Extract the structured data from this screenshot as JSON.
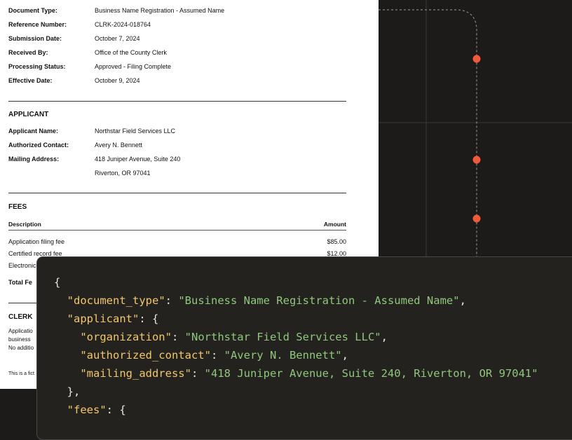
{
  "document": {
    "fields": [
      {
        "label": "Document Type:",
        "value": "Business Name Registration - Assumed Name"
      },
      {
        "label": "Reference Number:",
        "value": "CLRK-2024-018764"
      },
      {
        "label": "Submission Date:",
        "value": "October 7, 2024"
      },
      {
        "label": "Received By:",
        "value": "Office of the County Clerk"
      },
      {
        "label": "Processing Status:",
        "value": "Approved - Filing Complete"
      },
      {
        "label": "Effective Date:",
        "value": "October 9, 2024"
      }
    ],
    "applicant": {
      "heading": "APPLICANT",
      "name_label": "Applicant Name:",
      "name": "Northstar Field Services LLC",
      "contact_label": "Authorized Contact:",
      "contact": "Avery N. Bennett",
      "address_label": "Mailing Address:",
      "address_line1": "418 Juniper Avenue, Suite 240",
      "address_line2": "Riverton, OR 97041"
    },
    "fees": {
      "heading": "FEES",
      "col_description": "Description",
      "col_amount": "Amount",
      "items": [
        {
          "description": "Application filing fee",
          "amount": "$85.00"
        },
        {
          "description": "Certified record fee",
          "amount": "$12.00"
        },
        {
          "description": "Electronic",
          "amount": ""
        }
      ],
      "total_label": "Total Fe"
    },
    "clerk": {
      "heading": "CLERK",
      "lines": [
        "Applicatio",
        "business",
        "No additio"
      ]
    },
    "footer": "This is a fict"
  },
  "code": {
    "open": "{",
    "document_type_key": "\"document_type\"",
    "document_type_val": "\"Business Name Registration - Assumed Name\"",
    "applicant_key": "\"applicant\"",
    "organization_key": "\"organization\"",
    "organization_val": "\"Northstar Field Services LLC\"",
    "authorized_contact_key": "\"authorized_contact\"",
    "authorized_contact_val": "\"Avery N. Bennett\"",
    "mailing_address_key": "\"mailing_address\"",
    "mailing_address_val": "\"418 Juniper Avenue, Suite 240, Riverton, OR 97041\"",
    "close_applicant": "},",
    "fees_key": "\"fees\""
  },
  "colors": {
    "background": "#1c1b19",
    "marker": "#f05a3c",
    "code_key": "#f2c66c",
    "code_string": "#8fc77c"
  }
}
